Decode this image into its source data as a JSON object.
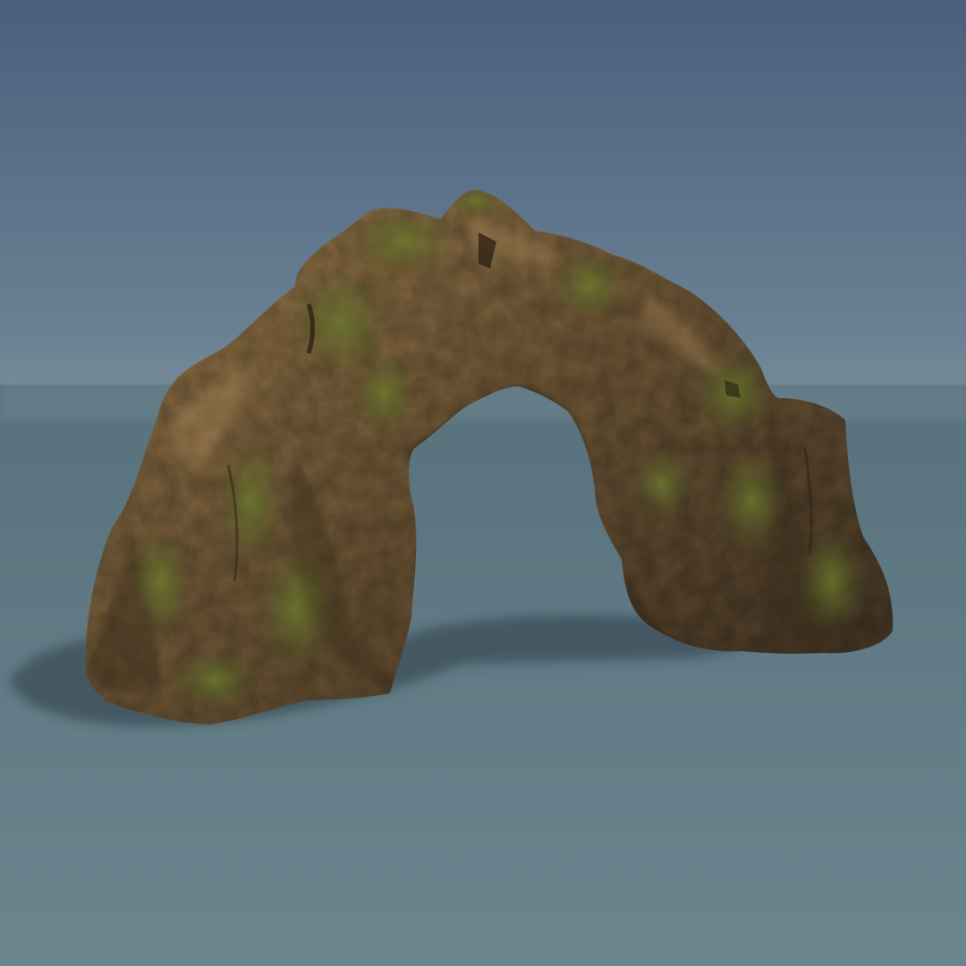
{
  "scene": {
    "subject": "rock-arch",
    "colors": {
      "sky_top": "#4a5f7e",
      "sky_horizon": "#6f8796",
      "ground_near": "#6a858e",
      "ground_far": "#58727d",
      "shadow": "#3a4e58",
      "rock_base": "#6e5636",
      "rock_light": "#9a7a4c",
      "rock_dark": "#3f3122",
      "moss": "#6d7a2e",
      "moss_dark": "#4d5a22"
    }
  }
}
